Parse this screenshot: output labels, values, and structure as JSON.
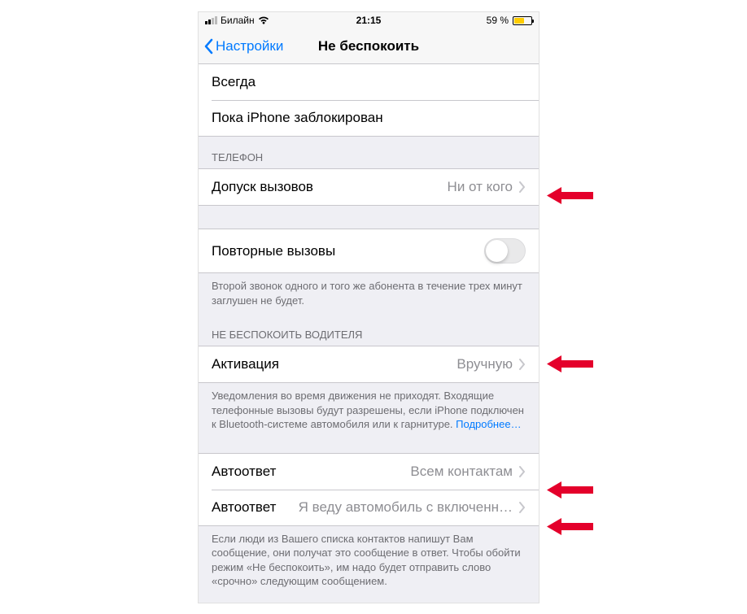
{
  "status": {
    "carrier": "Билайн",
    "time": "21:15",
    "battery_pct": "59 %"
  },
  "nav": {
    "back_label": "Настройки",
    "title": "Не беспокоить"
  },
  "silence": {
    "always": "Всегда",
    "while_locked": "Пока iPhone заблокирован"
  },
  "phone_section": {
    "header": "ТЕЛЕФОН",
    "allow_calls_label": "Допуск вызовов",
    "allow_calls_value": "Ни от кого"
  },
  "repeated": {
    "label": "Повторные вызовы",
    "footer": "Второй звонок одного и того же абонента в течение трех минут заглушен не будет."
  },
  "dndwd": {
    "header": "НЕ БЕСПОКОИТЬ ВОДИТЕЛЯ",
    "activate_label": "Активация",
    "activate_value": "Вручную",
    "footer_text": "Уведомления во время движения не приходят. Входящие телефонные вызовы будут разрешены, если iPhone подключен к Bluetooth-системе автомобиля или к гарнитуре. ",
    "learn_more": "Подробнее…"
  },
  "autoreply": {
    "to_label": "Автоответ",
    "to_value": "Всем контактам",
    "msg_label": "Автоответ",
    "msg_value": "Я веду автомобиль с включенн…",
    "footer": "Если люди из Вашего списка контактов напишут Вам сообщение, они получат это сообщение в ответ. Чтобы обойти режим «Не беспокоить», им надо будет отправить слово «срочно» следующим сообщением."
  }
}
